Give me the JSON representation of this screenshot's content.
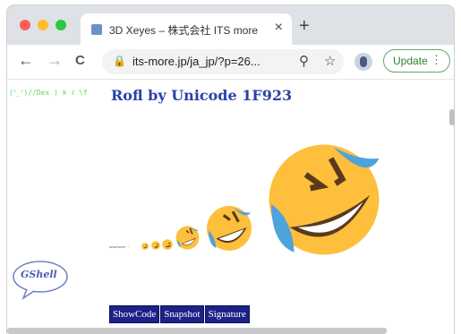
{
  "window": {
    "controls": {
      "close_color": "#ff5f57",
      "minimize_color": "#febc2e",
      "maximize_color": "#28c840"
    }
  },
  "tab": {
    "favicon": "page-favicon",
    "title": "3D Xeyes – 株式会社 ITS more",
    "close": "×"
  },
  "new_tab": "+",
  "toolbar": {
    "back": "←",
    "forward": "→",
    "reload": "C",
    "lock": "lock-icon",
    "url": "its-more.jp/ja_jp/?p=26...",
    "zoom_icon": "zoom-icon",
    "bookmark": "☆",
    "update": "Update",
    "menu": "⋮"
  },
  "page": {
    "ascii": "(ᐠ_ᐟ)//Dex ) k ℓ \\f",
    "heading": "Rofl by Unicode 1F923",
    "tiny_text": "seachwes. ~",
    "emoji_char": "🤣",
    "emoji_color": "#fdbf3c",
    "gshell": "GShell",
    "buttons": [
      "ShowCode",
      "Snapshot",
      "Signature"
    ]
  }
}
